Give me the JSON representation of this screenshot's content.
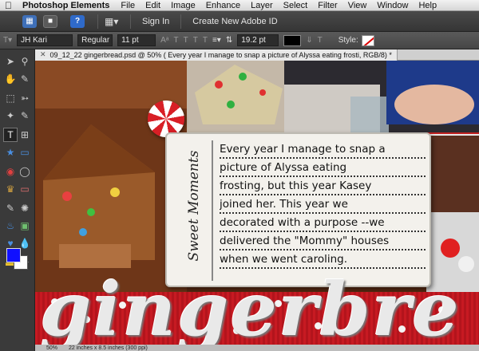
{
  "menubar": {
    "app_name": "Photoshop Elements",
    "menus": [
      "File",
      "Edit",
      "Image",
      "Enhance",
      "Layer",
      "Select",
      "Filter",
      "View",
      "Window",
      "Help"
    ]
  },
  "appbar": {
    "sign_in": "Sign In",
    "create_id": "Create New Adobe ID"
  },
  "options": {
    "font_family": "JH Kari",
    "font_style": "Regular",
    "font_size": "11 pt",
    "leading": "19.2 pt",
    "style_label": "Style:",
    "text_color": "#000000"
  },
  "document": {
    "tab_title": "09_12_22 gingerbread.psd @ 50% ( Every year I manage to snap a picture of Alyssa eating frosti, RGB/8) *",
    "card_side_title": "Sweet Moments",
    "journal_lines": [
      "Every year I manage to snap a",
      "picture of Alyssa eating",
      "frosting, but this year Kasey",
      "joined her. This year we",
      "decorated with a purpose --we",
      "delivered the \"Mommy\" houses",
      "when we went caroling."
    ],
    "title_text": "gingerbre"
  },
  "colors": {
    "foreground": "#1010ff",
    "background": "#ffffff"
  },
  "status": {
    "zoom": "50%",
    "doc_size": "22 inches x 8.5 inches (300 ppi)"
  }
}
